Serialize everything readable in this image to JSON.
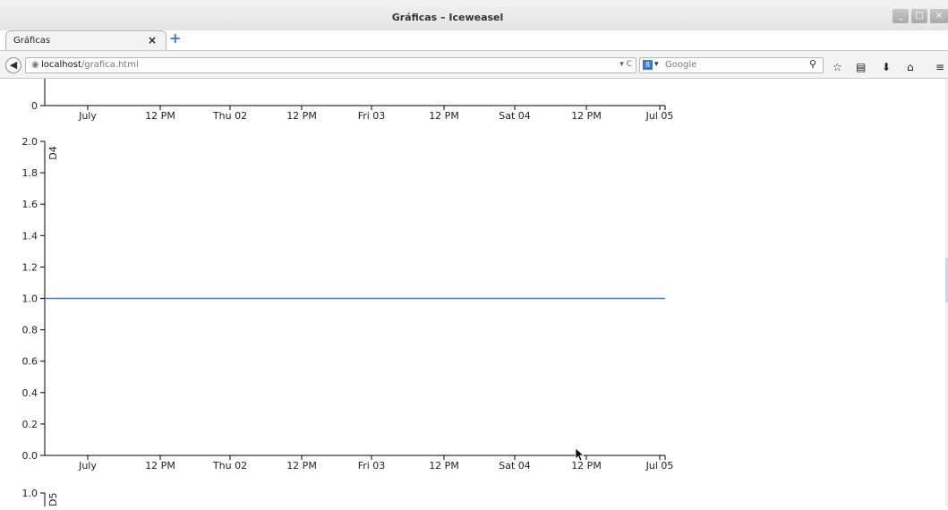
{
  "window": {
    "title": "Gráficas – Iceweasel",
    "minimize": "_",
    "maximize": "□",
    "close": "×"
  },
  "tab": {
    "label": "Gráficas",
    "close": "×",
    "new_tab": "+"
  },
  "navbar": {
    "back": "◀",
    "url_host": "localhost",
    "url_path": "/grafica.html",
    "url_tools": "▾ C",
    "search_engine": "8",
    "search_engine_arrow": "▾",
    "search_placeholder": "Google",
    "search_button": "🔍",
    "icons": [
      "star-icon",
      "reading-list-icon",
      "download-icon",
      "home-icon",
      "menu-icon"
    ]
  },
  "colors": {
    "line": "#3b79c9",
    "axis": "#000000",
    "text": "#222222"
  },
  "chart_data": [
    {
      "type": "line",
      "title": "",
      "ylabel": "",
      "yticks": [
        "0"
      ],
      "xticks": [
        "July",
        "12 PM",
        "Thu 02",
        "12 PM",
        "Fri 03",
        "12 PM",
        "Sat 04",
        "12 PM",
        "Jul 05"
      ],
      "series": [],
      "partial": true
    },
    {
      "type": "line",
      "ylabel": "D4",
      "ylim": [
        0.0,
        2.0
      ],
      "yticks": [
        "0.0",
        "0.2",
        "0.4",
        "0.6",
        "0.8",
        "1.0",
        "1.2",
        "1.4",
        "1.6",
        "1.8",
        "2.0"
      ],
      "xticks": [
        "July",
        "12 PM",
        "Thu 02",
        "12 PM",
        "Fri 03",
        "12 PM",
        "Sat 04",
        "12 PM",
        "Jul 05"
      ],
      "x": [
        "July",
        "Jul 05"
      ],
      "series": [
        {
          "values": [
            1.0,
            1.0
          ]
        }
      ]
    },
    {
      "type": "line",
      "ylabel": "D5",
      "yticks": [
        "1.0"
      ],
      "series": [],
      "partial": true
    }
  ]
}
